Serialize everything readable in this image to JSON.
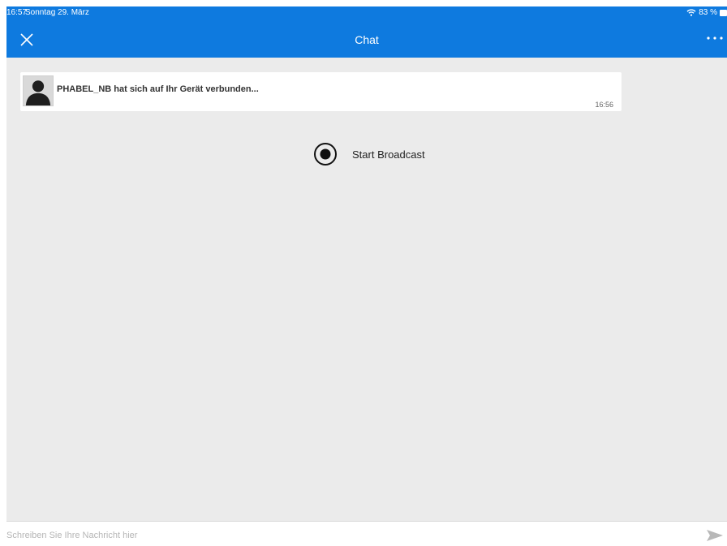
{
  "status_bar": {
    "time": "16:57",
    "date": "Sonntag 29. März",
    "battery": "83 %",
    "icons": [
      "wifi-icon",
      "battery-icon"
    ]
  },
  "header": {
    "title": "Chat",
    "icons": {
      "left": "close-icon",
      "right": "more-icon"
    },
    "color": "#0e7adf"
  },
  "messages": [
    {
      "text": "PHABEL_NB hat sich auf Ihr Gerät verbunden...",
      "time": "16:56",
      "avatar_icon": "avatar-silhouette-icon"
    }
  ],
  "broadcast": {
    "label": "Start Broadcast",
    "icon": "record-icon"
  },
  "composer": {
    "value": "",
    "placeholder": "Schreiben Sie Ihre Nachricht hier",
    "send_icon": "send-icon"
  },
  "colors": {
    "background": "#ebebeb",
    "card": "#ffffff",
    "header_text": "#ffffff"
  }
}
